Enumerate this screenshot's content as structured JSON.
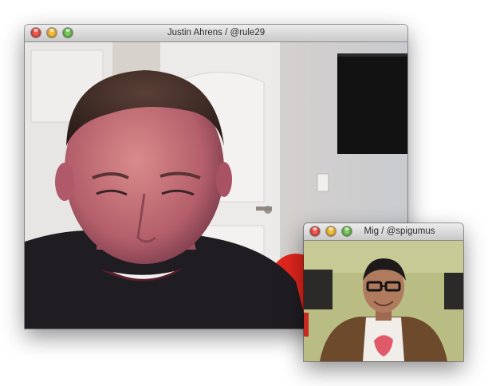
{
  "windows": {
    "main": {
      "title": "Justin Ahrens / @rule29",
      "controls": {
        "close": "close-button",
        "minimize": "minimize-button",
        "zoom": "zoom-button"
      }
    },
    "secondary": {
      "title": "Mig / @spigumus",
      "controls": {
        "close": "close-button",
        "minimize": "minimize-button",
        "zoom": "zoom-button"
      }
    }
  }
}
